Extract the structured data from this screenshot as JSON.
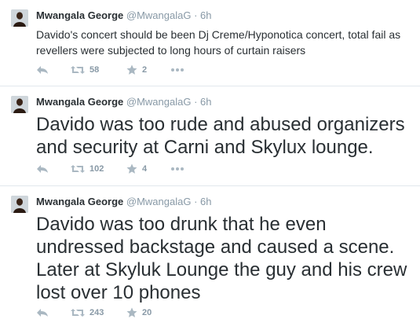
{
  "tweets": [
    {
      "author": "Mwangala George",
      "handle": "@MwangalaG",
      "separator": "·",
      "time": "6h",
      "text": "Davido's concert should be been Dj Creme/Hyponotica concert, total fail as revellers were subjected to long hours of curtain raisers",
      "retweets": "58",
      "favorites": "2"
    },
    {
      "author": "Mwangala George",
      "handle": "@MwangalaG",
      "separator": "·",
      "time": "6h",
      "text": "Davido was too rude and abused organizers and security at Carni and Skylux lounge.",
      "retweets": "102",
      "favorites": "4"
    },
    {
      "author": "Mwangala George",
      "handle": "@MwangalaG",
      "separator": "·",
      "time": "6h",
      "text": "Davido was too drunk that he even undressed backstage and caused a scene. Later at Skyluk Lounge the guy and his crew lost over 10 phones",
      "retweets": "243",
      "favorites": "20"
    }
  ],
  "colors": {
    "text": "#292f33",
    "muted": "#8899a6",
    "icon": "#aab8c2",
    "divider": "#e1e8ed"
  },
  "icons": [
    "avatar",
    "reply-icon",
    "retweet-icon",
    "star-icon",
    "more-icon"
  ]
}
